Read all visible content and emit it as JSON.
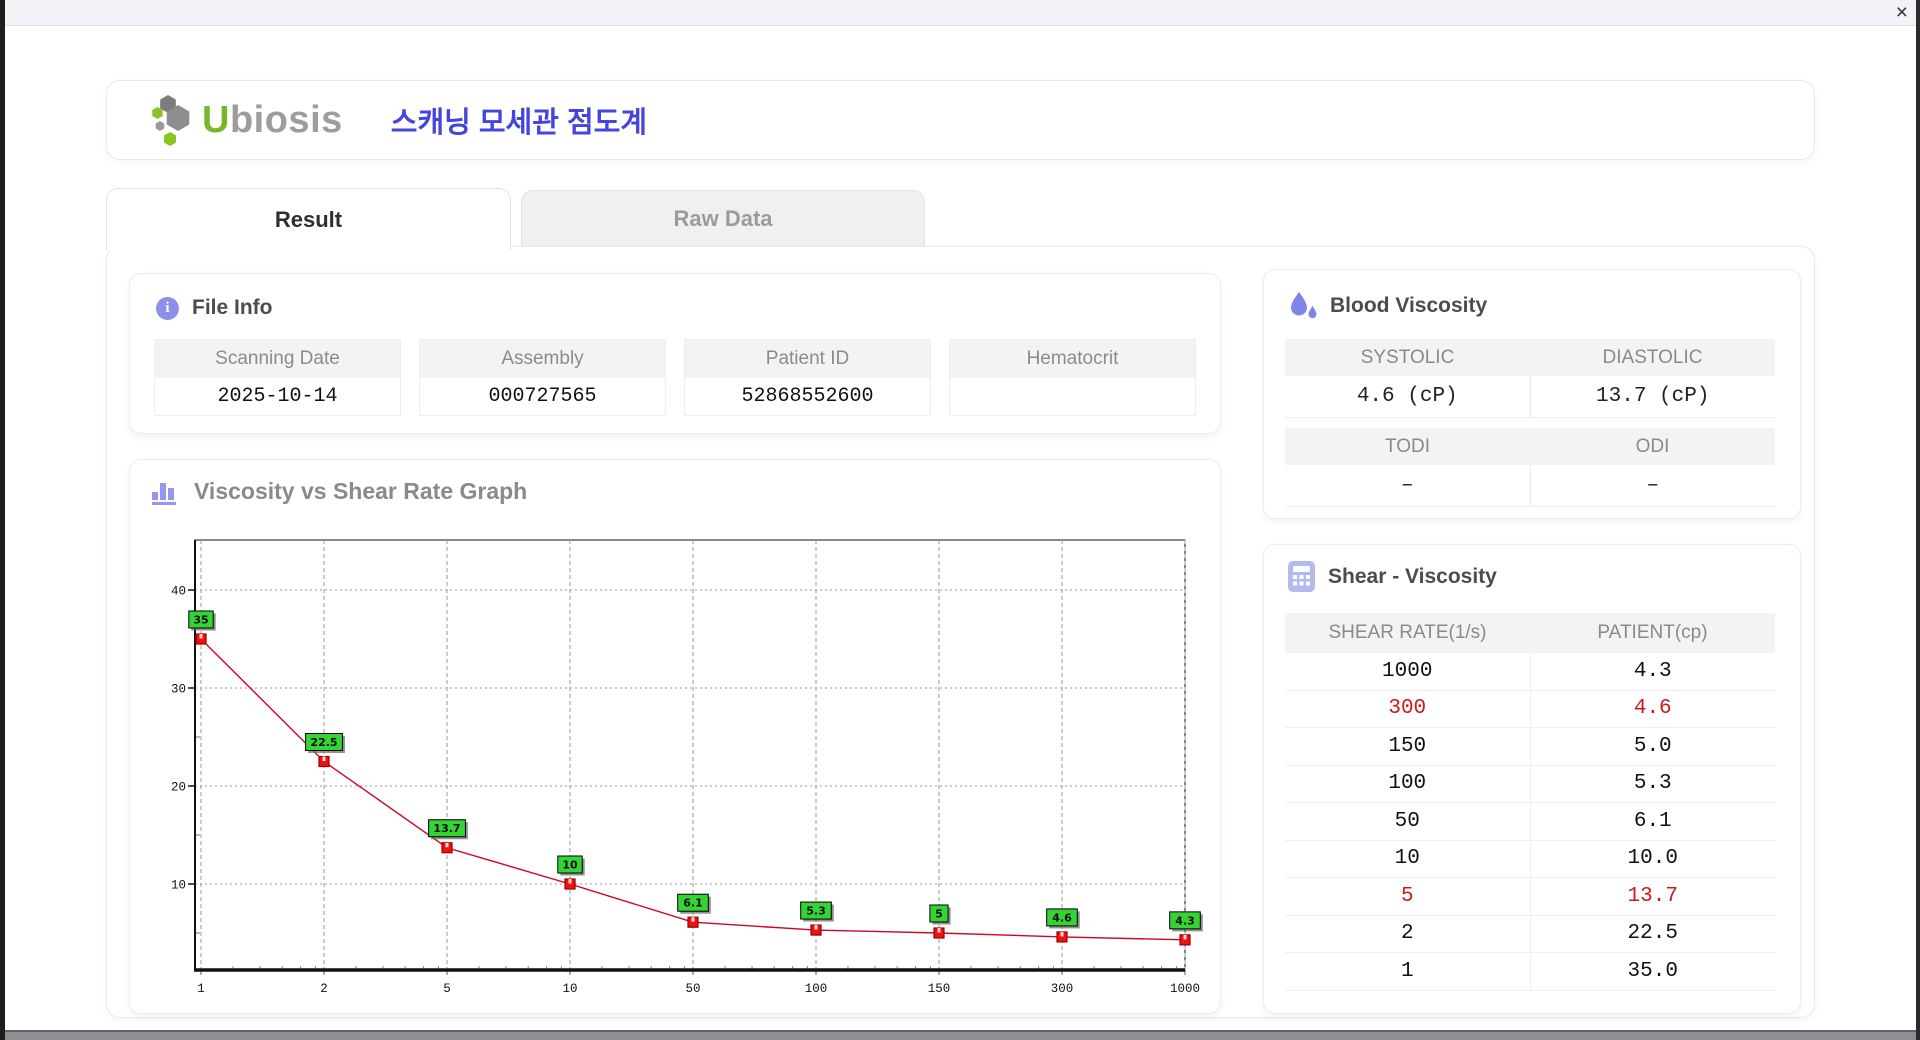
{
  "window": {
    "close_label": "×"
  },
  "header": {
    "brand_u": "U",
    "brand_rest": "biosis",
    "app_title": "스캐닝 모세관 점도계"
  },
  "tabs": [
    {
      "label": "Result",
      "active": true
    },
    {
      "label": "Raw Data",
      "active": false
    }
  ],
  "file_info": {
    "title": "File Info",
    "fields": [
      {
        "label": "Scanning Date",
        "value": "2025-10-14"
      },
      {
        "label": "Assembly",
        "value": "000727565"
      },
      {
        "label": "Patient ID",
        "value": "52868552600"
      },
      {
        "label": "Hematocrit",
        "value": ""
      }
    ]
  },
  "graph": {
    "title": "Viscosity vs Shear Rate Graph"
  },
  "chart_data": {
    "type": "line",
    "title": "Viscosity vs Shear Rate Graph",
    "x_labels": [
      "1",
      "2",
      "5",
      "10",
      "50",
      "100",
      "150",
      "300",
      "1000"
    ],
    "series": [
      {
        "name": "PATIENT",
        "values": [
          35,
          22.5,
          13.7,
          10,
          6.1,
          5.3,
          5,
          4.6,
          4.3
        ]
      }
    ],
    "point_labels": [
      "35",
      "22.5",
      "13.7",
      "10",
      "6.1",
      "5.3",
      "5",
      "4.6",
      "4.3"
    ],
    "y_ticks": [
      10,
      20,
      30,
      40
    ],
    "ylim": [
      1.2,
      45.1
    ],
    "xlabel": "",
    "ylabel": "",
    "x_axis_type": "log-like categories",
    "grid": true,
    "legend": false,
    "line_color": "#cc0822",
    "marker_color": "#ee1111",
    "label_box_color": "#33d433"
  },
  "blood_viscosity": {
    "title": "Blood Viscosity",
    "groups": [
      {
        "headers": [
          "SYSTOLIC",
          "DIASTOLIC"
        ],
        "values": [
          "4.6 (cP)",
          "13.7 (cP)"
        ]
      },
      {
        "headers": [
          "TODI",
          "ODI"
        ],
        "values": [
          "–",
          "–"
        ]
      }
    ]
  },
  "shear_viscosity": {
    "title": "Shear - Viscosity",
    "columns": [
      "SHEAR RATE(1/s)",
      "PATIENT(cp)"
    ],
    "rows": [
      {
        "shear_rate": "1000",
        "patient": "4.3",
        "highlight": false
      },
      {
        "shear_rate": "300",
        "patient": "4.6",
        "highlight": true
      },
      {
        "shear_rate": "150",
        "patient": "5.0",
        "highlight": false
      },
      {
        "shear_rate": "100",
        "patient": "5.3",
        "highlight": false
      },
      {
        "shear_rate": "50",
        "patient": "6.1",
        "highlight": false
      },
      {
        "shear_rate": "10",
        "patient": "10.0",
        "highlight": false
      },
      {
        "shear_rate": "5",
        "patient": "13.7",
        "highlight": true
      },
      {
        "shear_rate": "2",
        "patient": "22.5",
        "highlight": false
      },
      {
        "shear_rate": "1",
        "patient": "35.0",
        "highlight": false
      }
    ]
  },
  "colors": {
    "accent_purple": "#8b90e9",
    "brand_green": "#76b82a",
    "brand_gray": "#9d9d9d",
    "title_blue": "#4345dd",
    "highlight_red": "#d01818"
  }
}
